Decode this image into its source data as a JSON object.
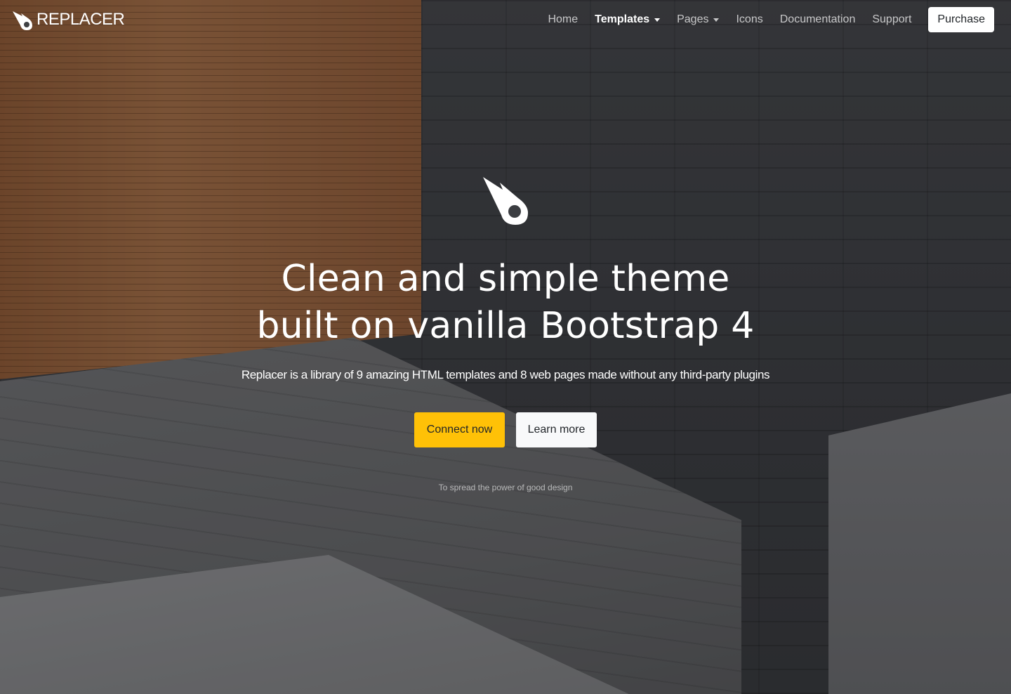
{
  "brand": {
    "name": "REPLACER",
    "logo_icon": "comet-icon"
  },
  "nav": {
    "items": [
      {
        "label": "Home",
        "active": false,
        "dropdown": false
      },
      {
        "label": "Templates",
        "active": true,
        "dropdown": true
      },
      {
        "label": "Pages",
        "active": false,
        "dropdown": true
      },
      {
        "label": "Icons",
        "active": false,
        "dropdown": false
      },
      {
        "label": "Documentation",
        "active": false,
        "dropdown": false
      },
      {
        "label": "Support",
        "active": false,
        "dropdown": false
      }
    ],
    "purchase_label": "Purchase"
  },
  "hero": {
    "icon": "comet-icon",
    "title_line1": "Clean and simple theme",
    "title_line2": "built on vanilla Bootstrap 4",
    "lead": "Replacer is a library of 9 amazing HTML templates and 8 web pages made without any third-party plugins",
    "primary_cta": "Connect now",
    "secondary_cta": "Learn more",
    "note": "To spread the power of good design"
  },
  "colors": {
    "primary": "#ffc107",
    "light": "#f8f9fa",
    "text_dark": "#212529"
  }
}
